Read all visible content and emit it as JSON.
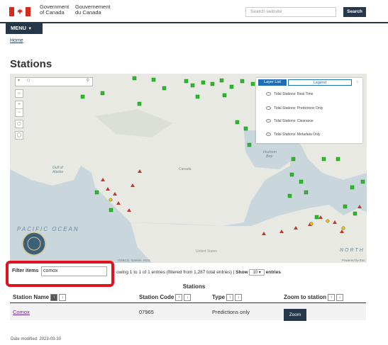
{
  "header": {
    "gov_en_line1": "Government",
    "gov_en_line2": "of Canada",
    "gov_fr_line1": "Gouvernement",
    "gov_fr_line2": "du Canada",
    "search_placeholder": "Search website",
    "search_button": "Search"
  },
  "nav": {
    "menu_label": "MENU",
    "breadcrumb_home": "Home"
  },
  "page": {
    "title": "Stations",
    "date_modified": "Date modified: 2023-03-30"
  },
  "map": {
    "search_placeholder": "Q",
    "layer_panel": {
      "tab_layer_list": "Layer List",
      "tab_legend": "Legend",
      "layers": [
        "Tidal Stations: Real Time",
        "Tidal Stations: Predictions Only",
        "Tidal Stations: Clearance",
        "Tidal Stations: Metadata Only"
      ]
    },
    "labels": {
      "canada": "Canada",
      "hudson_bay_1": "Hudson",
      "hudson_bay_2": "Bay",
      "gulf_alaska_1": "Gulf of",
      "gulf_alaska_2": "Alaska",
      "pacific": "PACIFIC OCEAN",
      "north": "NORTH",
      "united_states": "United States",
      "attribution": "GEBCO, Garmin, NGS",
      "powered_by": "Powered by Esri"
    },
    "colors": {
      "marker_green": "#2eb82e",
      "marker_red": "#c0392b",
      "water": "#c9d6dc",
      "land": "#e7e9e2"
    }
  },
  "table_controls": {
    "filter_label": "Filter items",
    "filter_value": "comox",
    "info_text": "owing 1 to 1 of 1 entries (filtered from 1,287 total entries)",
    "separator": "|",
    "show_label": "Show",
    "show_value": "10",
    "entries_label": "entries"
  },
  "table": {
    "caption": "Stations",
    "columns": [
      "Station Name",
      "Station Code",
      "Type",
      "Zoom to station"
    ],
    "rows": [
      {
        "name": "Comox",
        "code": "07965",
        "type": "Predictions only",
        "zoom": "Zoom"
      }
    ]
  }
}
